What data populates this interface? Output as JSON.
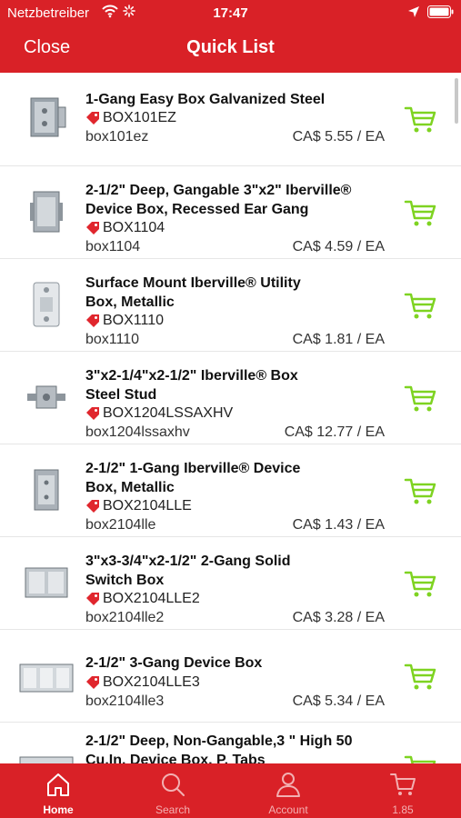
{
  "status_bar": {
    "carrier": "Netzbetreiber",
    "time": "17:47"
  },
  "nav": {
    "close_label": "Close",
    "title": "Quick List"
  },
  "colors": {
    "brand_red": "#d92127",
    "cart_green": "#7ed321",
    "tag_red": "#e0262d"
  },
  "products": [
    {
      "name_lines": [
        "1-Gang Easy Box Galvanized Steel"
      ],
      "sku": "BOX101EZ",
      "code": "box101ez",
      "price": "CA$ 5.55 / EA",
      "icon": "cart-icon"
    },
    {
      "name_lines": [
        "2-1/2\" Deep, Gangable 3\"x2\" Iberville®",
        "Device Box, Recessed Ear Gang"
      ],
      "sku": "BOX1104",
      "code": "box1104",
      "price": "CA$ 4.59 / EA",
      "icon": "cart-icon"
    },
    {
      "name_lines": [
        "Surface Mount Iberville® Utility",
        "Box, Metallic"
      ],
      "sku": "BOX1110",
      "code": "box1110",
      "price": "CA$ 1.81 / EA",
      "icon": "cart-icon"
    },
    {
      "name_lines": [
        "3\"x2-1/4\"x2-1/2\" Iberville® Box",
        "Steel Stud"
      ],
      "sku": "BOX1204LSSAXHV",
      "code": "box1204lssaxhv",
      "price": "CA$ 12.77 / EA",
      "icon": "cart-icon"
    },
    {
      "name_lines": [
        "2-1/2\" 1-Gang Iberville® Device",
        "Box, Metallic"
      ],
      "sku": "BOX2104LLE",
      "code": "box2104lle",
      "price": "CA$ 1.43 / EA",
      "icon": "cart-icon"
    },
    {
      "name_lines": [
        "3\"x3-3/4\"x2-1/2\" 2-Gang Solid",
        "Switch Box"
      ],
      "sku": "BOX2104LLE2",
      "code": "box2104lle2",
      "price": "CA$ 3.28 / EA",
      "icon": "cart-icon"
    },
    {
      "name_lines": [
        "2-1/2\" 3-Gang Device Box"
      ],
      "sku": "BOX2104LLE3",
      "code": "box2104lle3",
      "price": "CA$ 5.34 / EA",
      "icon": "cart-icon"
    },
    {
      "name_lines": [
        "2-1/2\" Deep, Non-Gangable,3 \" High 50",
        "Cu.In. Device Box, P. Tabs"
      ],
      "sku": "",
      "code": "",
      "price": "",
      "icon": "cart-icon"
    }
  ],
  "tabbar": {
    "tabs": [
      {
        "label": "Home",
        "icon": "home-icon",
        "active": true
      },
      {
        "label": "Search",
        "icon": "search-icon",
        "active": false
      },
      {
        "label": "Account",
        "icon": "account-icon",
        "active": false
      },
      {
        "label": "1.85",
        "icon": "cart-icon",
        "active": false
      }
    ]
  }
}
